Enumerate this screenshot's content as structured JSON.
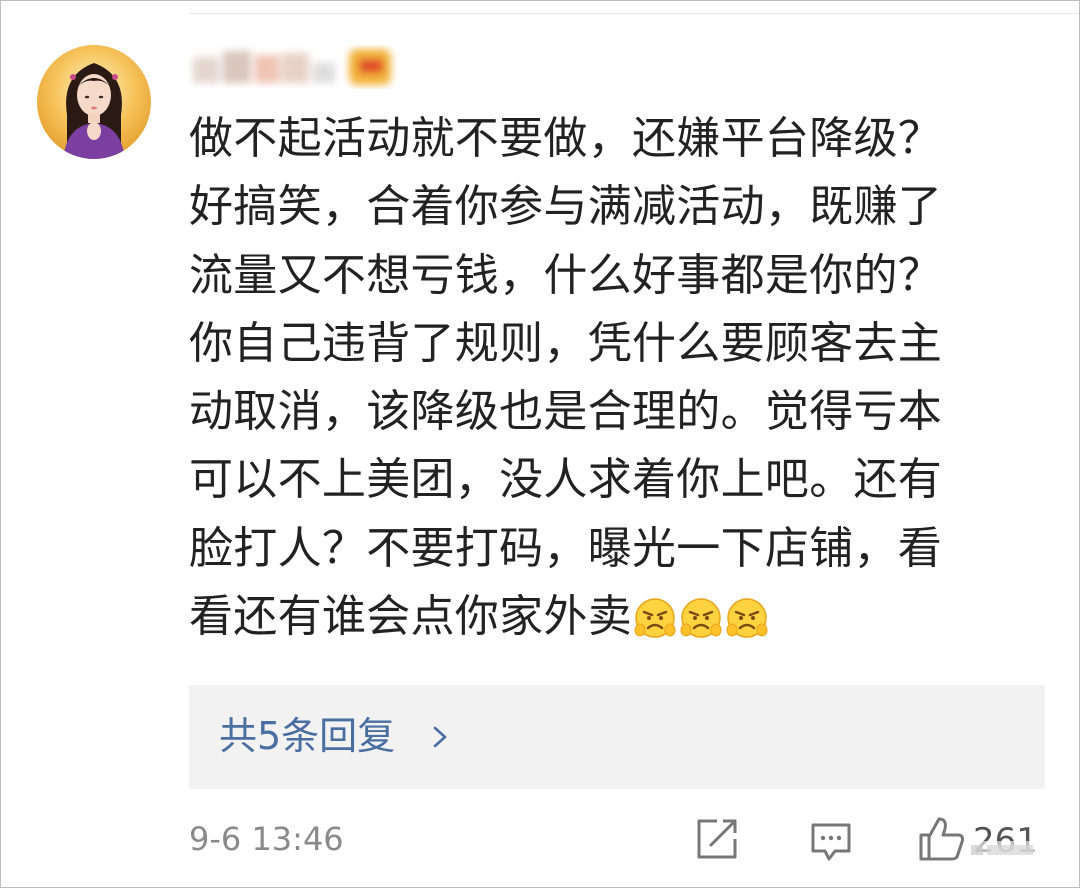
{
  "comment": {
    "lines": [
      "做不起活动就不要做，还嫌平台降级？",
      "好搞笑，合着你参与满减活动，既赚了",
      "流量又不想亏钱，什么好事都是你的？",
      "你自己违背了规则，凭什么要顾客去主",
      "动取消，该降级也是合理的。觉得亏本",
      "可以不上美团，没人求着你上吧。还有",
      "脸打人？不要打码，曝光一下店铺，看",
      "看还有谁会点你家外卖"
    ],
    "emojis": [
      "angry-face-emoji",
      "angry-face-emoji",
      "angry-face-emoji"
    ]
  },
  "replies": {
    "label": "共5条回复",
    "chevron": "chevron-right-icon"
  },
  "footer": {
    "timestamp": "9-6 13:46",
    "like_count": "261",
    "share_icon": "share-icon",
    "comment_icon": "comment-icon",
    "like_icon": "thumbs-up-icon"
  },
  "colors": {
    "link": "#4a6ea0",
    "text": "#222222",
    "meta": "#8a8a8a",
    "reply_bg": "#f2f2f2"
  }
}
